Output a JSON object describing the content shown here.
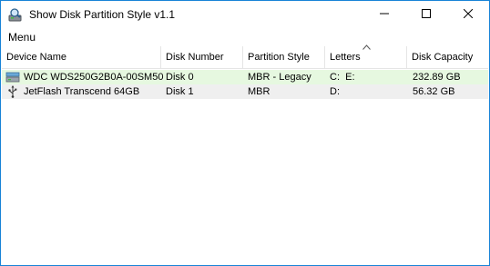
{
  "window": {
    "title": "Show Disk Partition Style v1.1",
    "icon": "disk-magnifier-icon"
  },
  "menu": {
    "items": [
      "Menu"
    ]
  },
  "table": {
    "columns": [
      "Device Name",
      "Disk Number",
      "Partition Style",
      "Letters",
      "Disk Capacity"
    ],
    "sorted_column": "Letters",
    "sort_direction": "ascending",
    "rows": [
      {
        "icon": "hard-drive-icon",
        "device": "WDC  WDS250G2B0A-00SM50",
        "disk_number": "Disk 0",
        "partition_style": "MBR - Legacy",
        "letters": "C:  E:",
        "capacity": "232.89 GB",
        "highlight": "#e6f8e0"
      },
      {
        "icon": "usb-icon",
        "device": "JetFlash Transcend 64GB",
        "disk_number": "Disk 1",
        "partition_style": "MBR",
        "letters": "D:",
        "capacity": "56.32 GB",
        "highlight": "#efefef"
      }
    ]
  }
}
